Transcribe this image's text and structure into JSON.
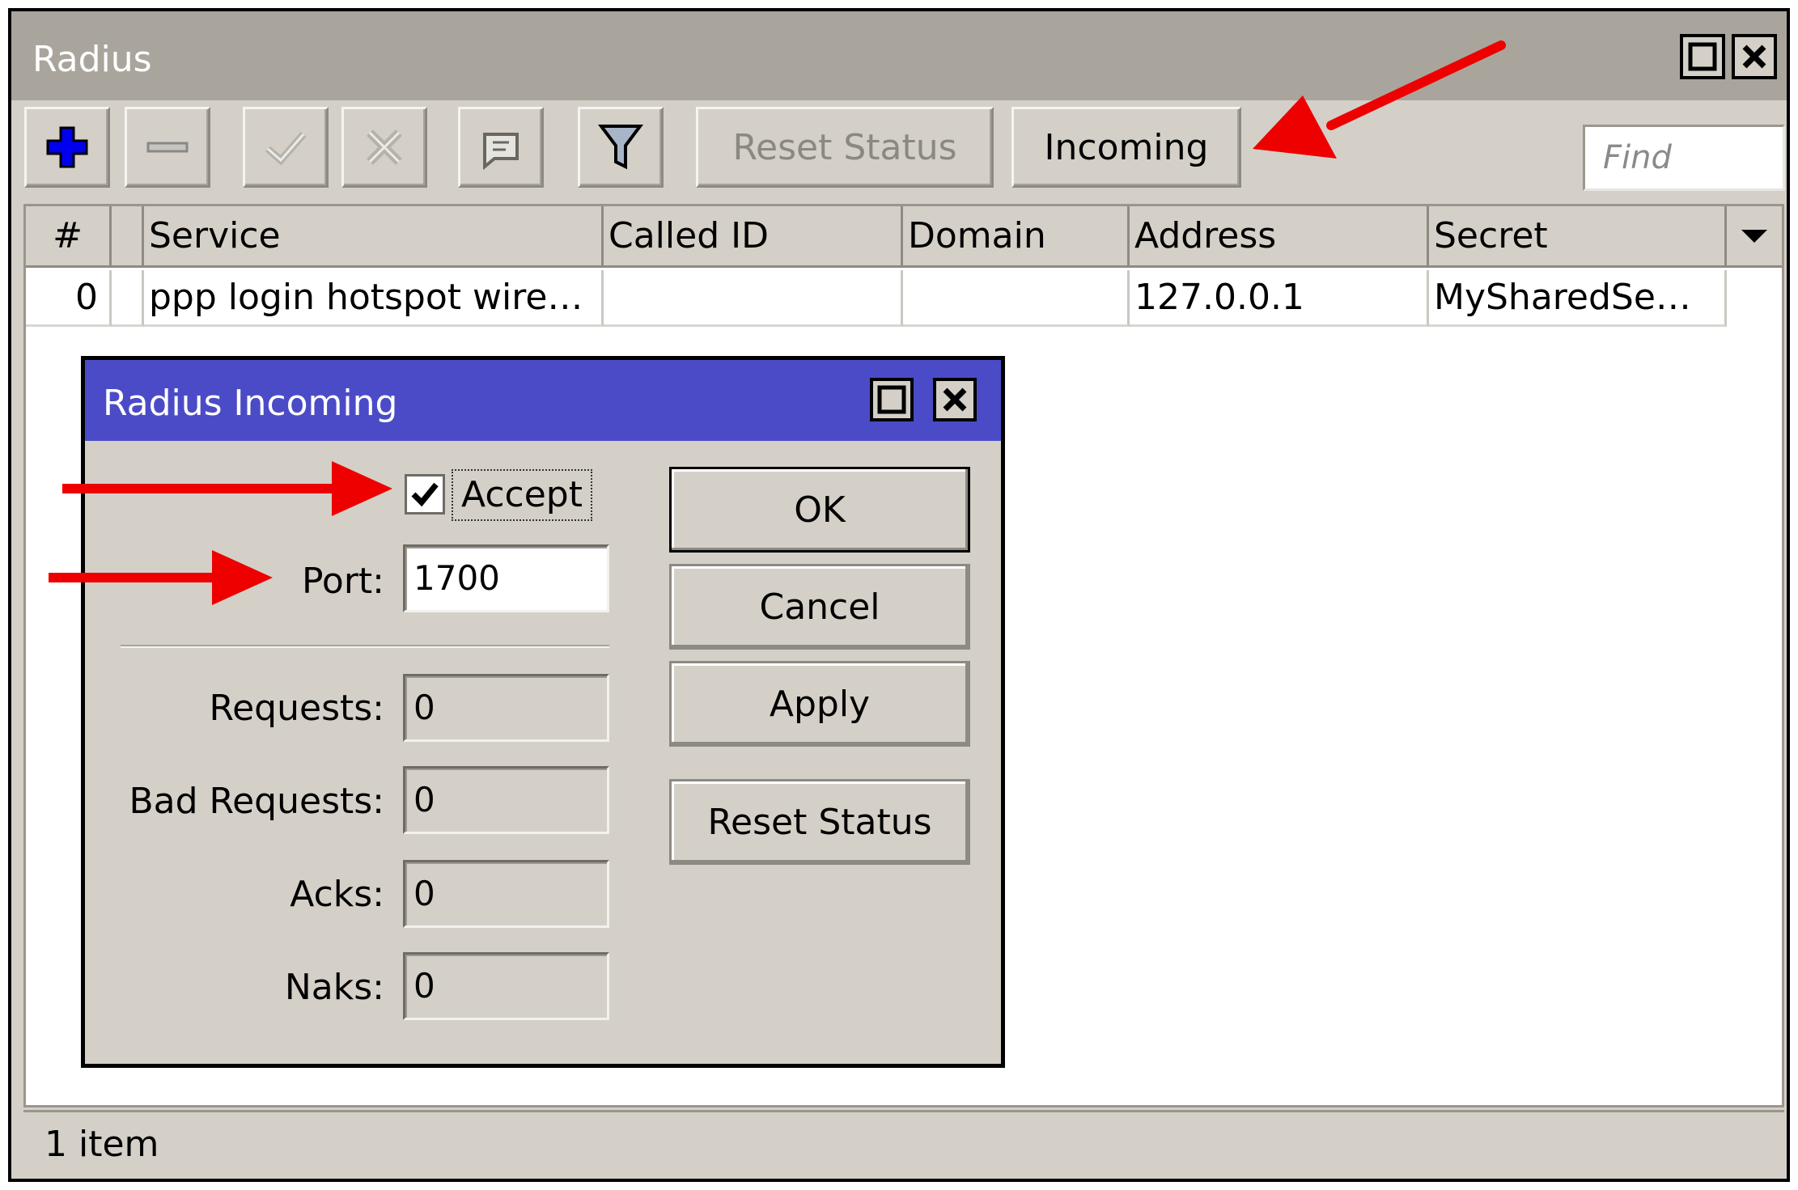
{
  "window": {
    "title": "Radius"
  },
  "toolbar": {
    "add_icon": "plus-icon",
    "remove_icon": "minus-icon",
    "enable_icon": "check-icon",
    "disable_icon": "x-icon",
    "comment_icon": "comment-icon",
    "filter_icon": "filter-icon",
    "reset_status_label": "Reset Status",
    "incoming_label": "Incoming",
    "find_placeholder": "Find"
  },
  "table": {
    "columns": [
      "#",
      "",
      "Service",
      "Called ID",
      "Domain",
      "Address",
      "Secret"
    ],
    "rows": [
      {
        "num": "0",
        "flag": "",
        "service": "ppp login hotspot wire…",
        "called_id": "",
        "domain": "",
        "address": "127.0.0.1",
        "secret": "MySharedSe…"
      }
    ]
  },
  "status": {
    "text": "1 item"
  },
  "dialog": {
    "title": "Radius Incoming",
    "accept_label": "Accept",
    "accept_checked": true,
    "port_label": "Port:",
    "port_value": "1700",
    "requests_label": "Requests:",
    "requests_value": "0",
    "bad_requests_label": "Bad Requests:",
    "bad_requests_value": "0",
    "acks_label": "Acks:",
    "acks_value": "0",
    "naks_label": "Naks:",
    "naks_value": "0",
    "ok_label": "OK",
    "cancel_label": "Cancel",
    "apply_label": "Apply",
    "reset_status_label": "Reset Status"
  },
  "colors": {
    "window_bg": "#d4d0c8",
    "main_titlebar": "#a9a59c",
    "dialog_titlebar": "#4b4bc8",
    "annotation_arrow": "#ee0000",
    "add_icon": "#0000ee"
  }
}
